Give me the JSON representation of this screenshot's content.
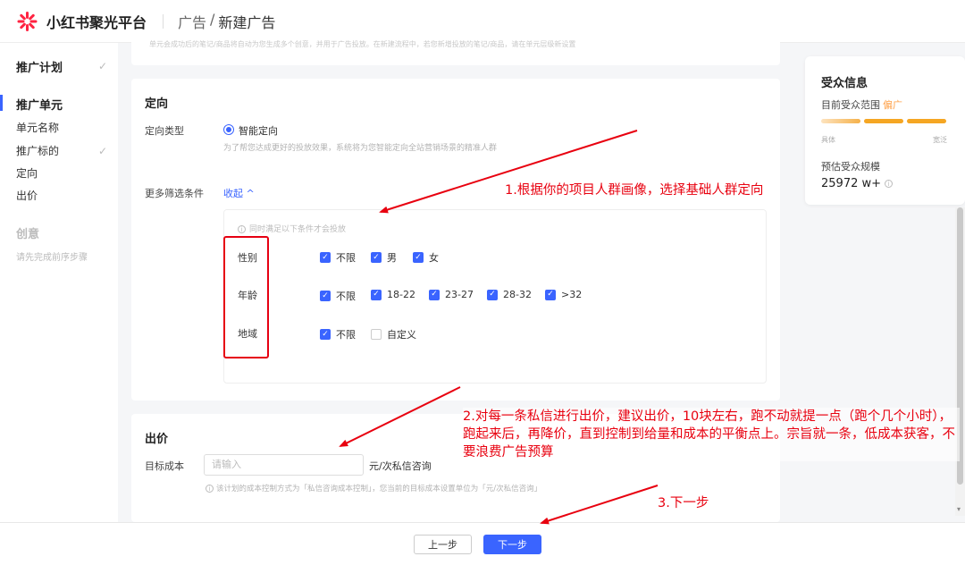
{
  "header": {
    "app_name": "小红书聚光平台",
    "breadcrumb": [
      "广告",
      "/",
      "新建广告"
    ]
  },
  "sidebar": {
    "plan": {
      "label": "推广计划",
      "done": "✓"
    },
    "unit": {
      "label": "推广单元"
    },
    "items": [
      {
        "label": "单元名称",
        "done": ""
      },
      {
        "label": "推广标的",
        "done": "✓"
      },
      {
        "label": "定向",
        "done": ""
      },
      {
        "label": "出价",
        "done": ""
      }
    ],
    "creative": {
      "label": "创意",
      "hint": "请先完成前序步骤"
    }
  },
  "top_panel": {
    "hint": "单元会成功后的笔记/商品将自动为您生成多个创意，并用于广告投放。在新建流程中，若您新增投放的笔记/商品，请在单元层级新设置"
  },
  "targeting": {
    "title": "定向",
    "type_label": "定向类型",
    "type_option": "智能定向",
    "type_hint": "为了帮您达成更好的投放效果，系统将为您智能定向全站营销场景的精准人群",
    "more_label": "更多筛选条件",
    "collapse_label": "收起 ^",
    "box_hint": "同时满足以下条件才会投放",
    "gender": {
      "label": "性别",
      "options": [
        "不限",
        "男",
        "女"
      ]
    },
    "age": {
      "label": "年龄",
      "options": [
        "不限",
        "18-22",
        "23-27",
        "28-32",
        ">32"
      ]
    },
    "region": {
      "label": "地域",
      "options": [
        "不限",
        "自定义"
      ]
    }
  },
  "bid": {
    "title": "出价",
    "cost_label": "目标成本",
    "placeholder": "请输入",
    "unit": "元/次私信咨询",
    "hint": "该计划的成本控制方式为「私信咨询成本控制」，您当前的目标成本设置单位为「元/次私信咨询」"
  },
  "audience": {
    "title": "受众信息",
    "range_label": "目前受众范围",
    "range_value": "偏广",
    "scale_left": "具体",
    "scale_right": "宽泛",
    "est_label": "预估受众规模",
    "est_value": "25972 w+",
    "info_icon": "ⓘ"
  },
  "footer": {
    "prev_label": "上一步",
    "next_label": "下一步"
  },
  "annotations": {
    "a1": "1.根据你的项目人群画像，选择基础人群定向",
    "a2": "2.对每一条私信进行出价，建议出价，10块左右，跑不动就提一点（跑个几个小时），跑起来后，再降价，直到控制到给量和成本的平衡点上。宗旨就一条，低成本获客，不要浪费广告预算",
    "a3": "3.下一步"
  },
  "colors": {
    "accent": "#3a64ff",
    "brand": "#ff2442",
    "annotation": "#e8000f",
    "audience_bar": "#f5a623"
  }
}
